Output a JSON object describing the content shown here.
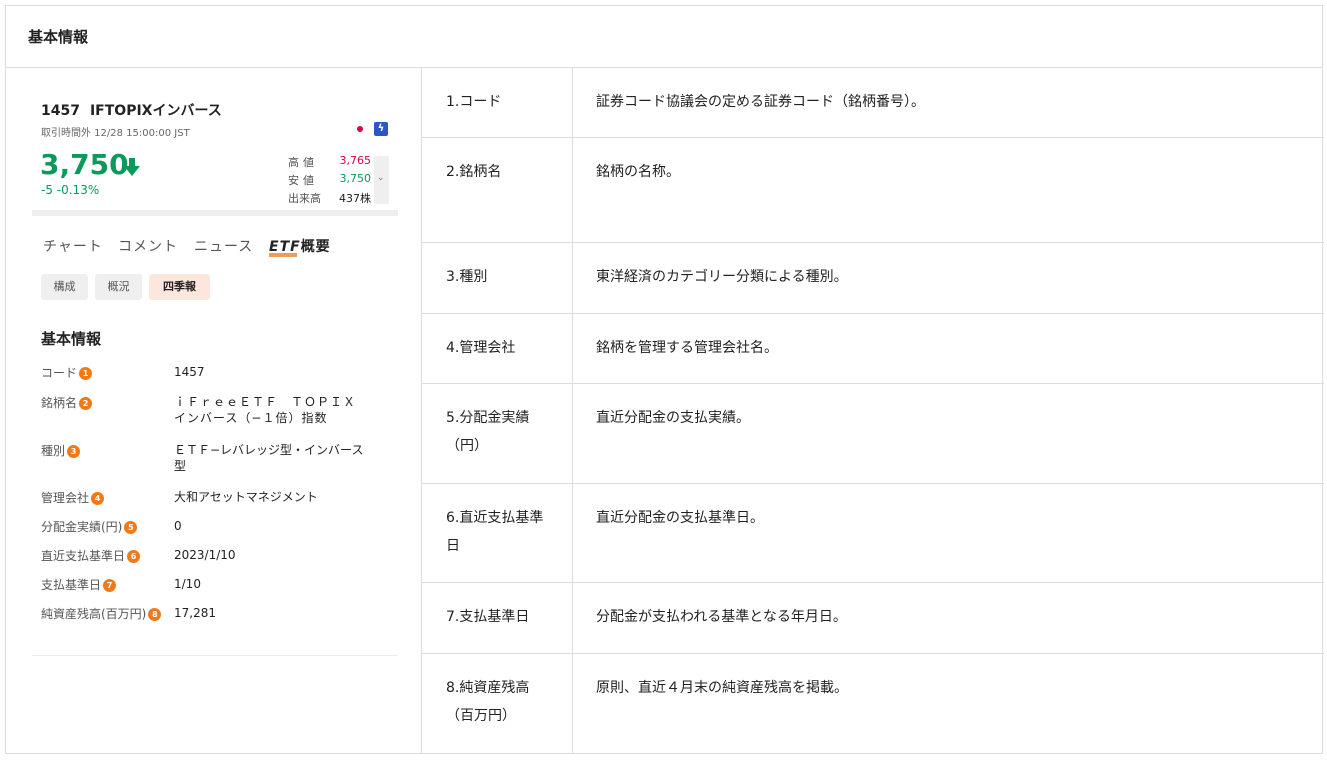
{
  "header": {
    "title": "基本情報"
  },
  "stock": {
    "code": "1457",
    "name": "IFTOPIXインバース",
    "time": "取引時間外 12/28 15:00:00 JST",
    "price": "3,750",
    "change": "-5 -0.13%",
    "high_label": "高値",
    "high_value": "3,765",
    "low_label": "安値",
    "low_value": "3,750",
    "volume_label": "出来高",
    "volume_value": "437株",
    "colors": {
      "up": "#d6004c",
      "down": "#0a9a5c",
      "accent": "#f07a1a"
    }
  },
  "tabs": [
    {
      "label": "チャート"
    },
    {
      "label": "コメント"
    },
    {
      "label": "ニュース"
    },
    {
      "label_prefix": "ETF",
      "label_suffix": "概要"
    }
  ],
  "subtabs": [
    {
      "label": "構成"
    },
    {
      "label": "概況"
    },
    {
      "label": "四季報"
    }
  ],
  "basic_info": {
    "title": "基本情報",
    "rows": [
      {
        "label": "コード",
        "badge": "1",
        "value": "1457"
      },
      {
        "label": "銘柄名",
        "badge": "2",
        "value": "ｉＦｒｅｅＥＴＦ　ＴＯＰＩＸ",
        "value2": "インバース（−１倍）指数"
      },
      {
        "label": "種別",
        "badge": "3",
        "value": "ＥＴＦ−レバレッジ型・インバース",
        "value2": "型"
      },
      {
        "label": "管理会社",
        "badge": "4",
        "value": "大和アセットマネジメント"
      },
      {
        "label": "分配金実績(円)",
        "badge": "5",
        "value": "0"
      },
      {
        "label": "直近支払基準日",
        "badge": "6",
        "value": "2023/1/10"
      },
      {
        "label": "支払基準日",
        "badge": "7",
        "value": "1/10"
      },
      {
        "label": "純資産残高(百万円)",
        "badge": "8",
        "value": "17,281"
      }
    ]
  },
  "definitions": [
    {
      "label": "1.コード",
      "desc": "証券コード協議会の定める証券コード（銘柄番号）。"
    },
    {
      "label": "2.銘柄名",
      "desc": "銘柄の名称。"
    },
    {
      "label": "3.種別",
      "desc": "東洋経済のカテゴリー分類による種別。"
    },
    {
      "label": "4.管理会社",
      "desc": "銘柄を管理する管理会社名。"
    },
    {
      "label": "5.分配金実績（円）",
      "desc": "直近分配金の支払実績。"
    },
    {
      "label": "6.直近支払基準日",
      "desc": "直近分配金の支払基準日。"
    },
    {
      "label": "7.支払基準日",
      "desc": "分配金が支払われる基準となる年月日。"
    },
    {
      "label": "8.純資産残高（百万円）",
      "desc": "原則、直近４月末の純資産残高を掲載。"
    }
  ]
}
